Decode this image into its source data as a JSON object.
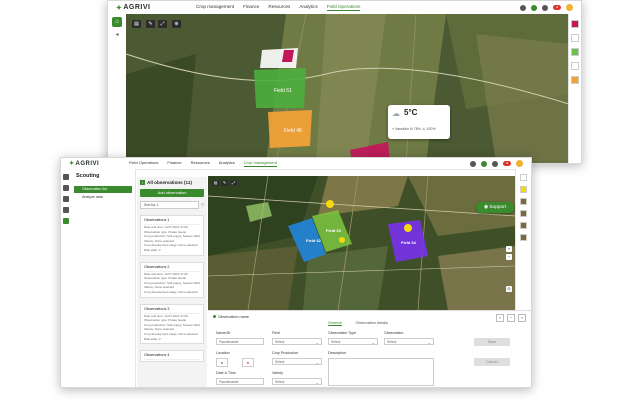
{
  "back_window": {
    "logo": "AGRIVI",
    "nav": [
      "Crop management",
      "Finance",
      "Resources",
      "Analytics",
      "Field Operations"
    ],
    "weather": {
      "temperature": "5°C",
      "place": "Varaždin",
      "humidity": "78%",
      "precipitation": "100%"
    },
    "colors": {
      "brand_green": "#3a8a2e"
    }
  },
  "front_window": {
    "logo": "AGRIVI",
    "nav": [
      "Field Operations",
      "Finance",
      "Resources",
      "Analytics",
      "Crop management"
    ],
    "scouting": {
      "title": "Scouting",
      "items": [
        "Observation list",
        "Analyze data"
      ]
    },
    "observations": {
      "header": "All observations (11)",
      "add_button": "Add observation",
      "sort_label": "Sort by: L",
      "cards": [
        {
          "title": "Observations 1",
          "lines": [
            "Date and time: 14.07.2023 17:00",
            "Observation type: Potato beetle",
            "Crop production: Soft poppy, Season 2023",
            "Variety: None selected",
            "Crop development stage: None selected",
            "Risk state: 3"
          ]
        },
        {
          "title": "Observations 2",
          "lines": [
            "Date and time: 14.07.2023 17:00",
            "Observation type: Potato beetle",
            "Crop production: Soft poppy, Season 2023",
            "Variety: None selected",
            "Crop development stage: None selected"
          ]
        },
        {
          "title": "Observations 3",
          "lines": [
            "Date and time: 14.07.2023 17:00",
            "Observation type: Potato beetle",
            "Crop production: Soft poppy, Season 2023",
            "Variety: None selected",
            "Crop development stage: None selected",
            "Risk state: 3"
          ]
        },
        {
          "title": "Observations 4",
          "lines": []
        }
      ]
    },
    "support_label": "Support",
    "fields_on_map": [
      "Field 62",
      "Field 63",
      "Field 64"
    ],
    "form": {
      "header": "Observation name",
      "tabs": [
        "General",
        "Observation details"
      ],
      "name_label": "Name/ID",
      "name_value": "Pauzlenaster",
      "field_label": "Field",
      "select_text": "Select",
      "obs_type_label": "Observation Type",
      "observation_label": "Observation",
      "location_label": "Location",
      "crop_production_label": "Crop Production",
      "description_label": "Description",
      "date_time_label": "Date & Time",
      "date_value": "Pauzlenaster",
      "variety_label": "Variety",
      "save_label": "Save",
      "cancel_label": "Cancel"
    }
  }
}
